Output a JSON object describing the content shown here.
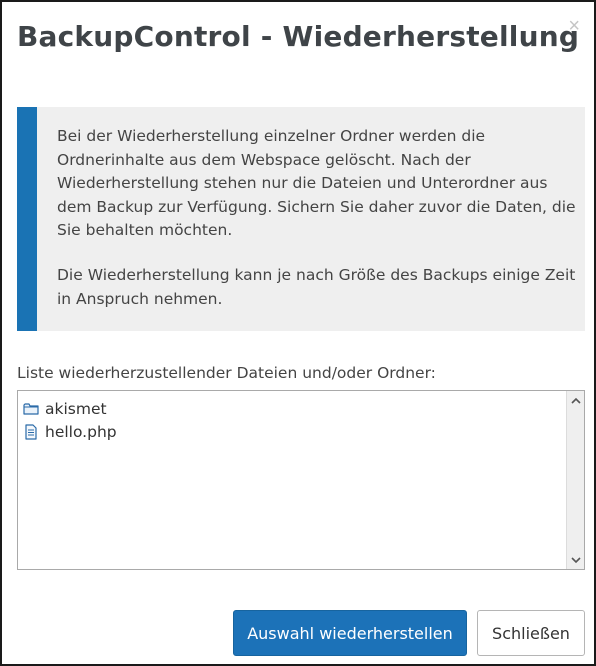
{
  "dialog": {
    "title": "BackupControl - Wiederherstellung",
    "close_symbol": "×"
  },
  "info_box": {
    "accent_color": "#1a73b4",
    "paragraph_1": "Bei der Wiederherstellung einzelner Ordner werden die Ordnerinhalte aus dem Webspace gelöscht. Nach der Wiederherstellung stehen nur die Dateien und Unterordner aus dem Backup zur Verfügung. Sichern Sie daher zuvor die Daten, die Sie behalten möchten.",
    "paragraph_2": "Die Wiederherstellung kann je nach Größe des Backups einige Zeit in Anspruch nehmen."
  },
  "restore_list": {
    "label": "Liste wiederherzustellender Dateien und/oder Ordner:",
    "items": [
      {
        "name": "akismet",
        "icon": "folder-icon"
      },
      {
        "name": "hello.php",
        "icon": "file-icon"
      }
    ]
  },
  "buttons": {
    "restore_label": "Auswahl wiederherstellen",
    "close_label": "Schließen",
    "primary_color": "#1c72b8"
  }
}
